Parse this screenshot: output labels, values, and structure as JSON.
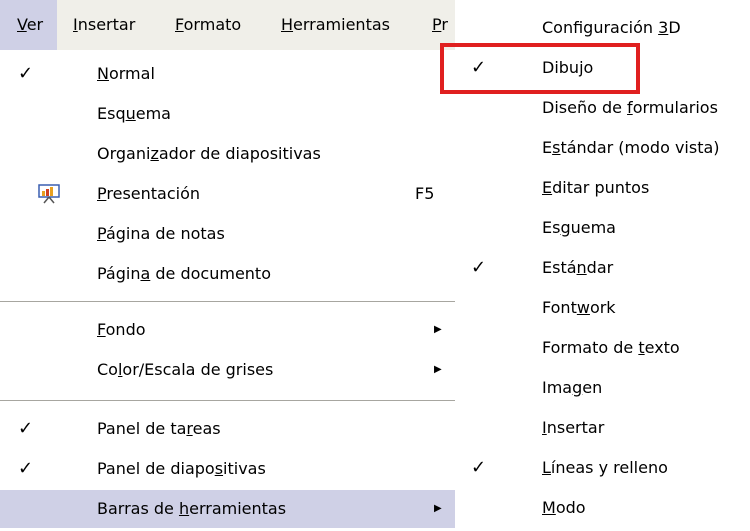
{
  "menubar": {
    "items": [
      {
        "pre": "",
        "u": "V",
        "post": "er",
        "active": true
      },
      {
        "pre": "",
        "u": "I",
        "post": "nsertar"
      },
      {
        "pre": "",
        "u": "F",
        "post": "ormato"
      },
      {
        "pre": "",
        "u": "H",
        "post": "erramientas"
      },
      {
        "pre": "",
        "u": "P",
        "post": "r"
      }
    ]
  },
  "view_menu": {
    "items": [
      {
        "pre": "",
        "u": "N",
        "post": "ormal",
        "checked": true
      },
      {
        "pre": "Esq",
        "u": "u",
        "post": "ema"
      },
      {
        "pre": "Organi",
        "u": "z",
        "post": "ador de diapositivas"
      },
      {
        "pre": "",
        "u": "P",
        "post": "resentación",
        "shortcut": "F5",
        "icon": "presentation-icon"
      },
      {
        "pre": "",
        "u": "P",
        "post": "ágina de notas"
      },
      {
        "pre": "Págin",
        "u": "a",
        "post": " de documento"
      },
      {
        "pre": "",
        "u": "F",
        "post": "ondo",
        "submenu": true
      },
      {
        "pre": "Co",
        "u": "l",
        "post": "or/Escala de grises",
        "submenu": true
      },
      {
        "pre": "Panel de ta",
        "u": "r",
        "post": "eas",
        "checked": true
      },
      {
        "pre": "Panel de diapo",
        "u": "s",
        "post": "itivas",
        "checked": true
      },
      {
        "pre": "Barras de ",
        "u": "h",
        "post": "erramientas",
        "submenu": true,
        "highlighted": true
      }
    ],
    "check_glyph": "✓",
    "arrow_glyph": "▶"
  },
  "toolbars_submenu": {
    "items": [
      {
        "pre": "Configuración ",
        "u": "3",
        "post": "D"
      },
      {
        "pre": "Dibu",
        "u": "j",
        "post": "o",
        "checked": true
      },
      {
        "pre": "Diseño de ",
        "u": "f",
        "post": "ormularios"
      },
      {
        "pre": "E",
        "u": "s",
        "post": "tándar (modo vista)"
      },
      {
        "pre": "",
        "u": "E",
        "post": "ditar puntos"
      },
      {
        "pre": "Es",
        "u": "g",
        "post": "uema"
      },
      {
        "pre": "Está",
        "u": "n",
        "post": "dar",
        "checked": true
      },
      {
        "pre": "Font",
        "u": "w",
        "post": "ork"
      },
      {
        "pre": "Formato de ",
        "u": "t",
        "post": "exto"
      },
      {
        "pre": "Ima",
        "u": "g",
        "post": "en"
      },
      {
        "pre": "",
        "u": "I",
        "post": "nsertar"
      },
      {
        "pre": "",
        "u": "L",
        "post": "íneas y relleno",
        "checked": true
      },
      {
        "pre": "",
        "u": "M",
        "post": "odo"
      }
    ]
  },
  "colors": {
    "highlight": "#cfd0e6",
    "menubar_bg": "#f0efe9",
    "annotation_box": "#e02020"
  }
}
